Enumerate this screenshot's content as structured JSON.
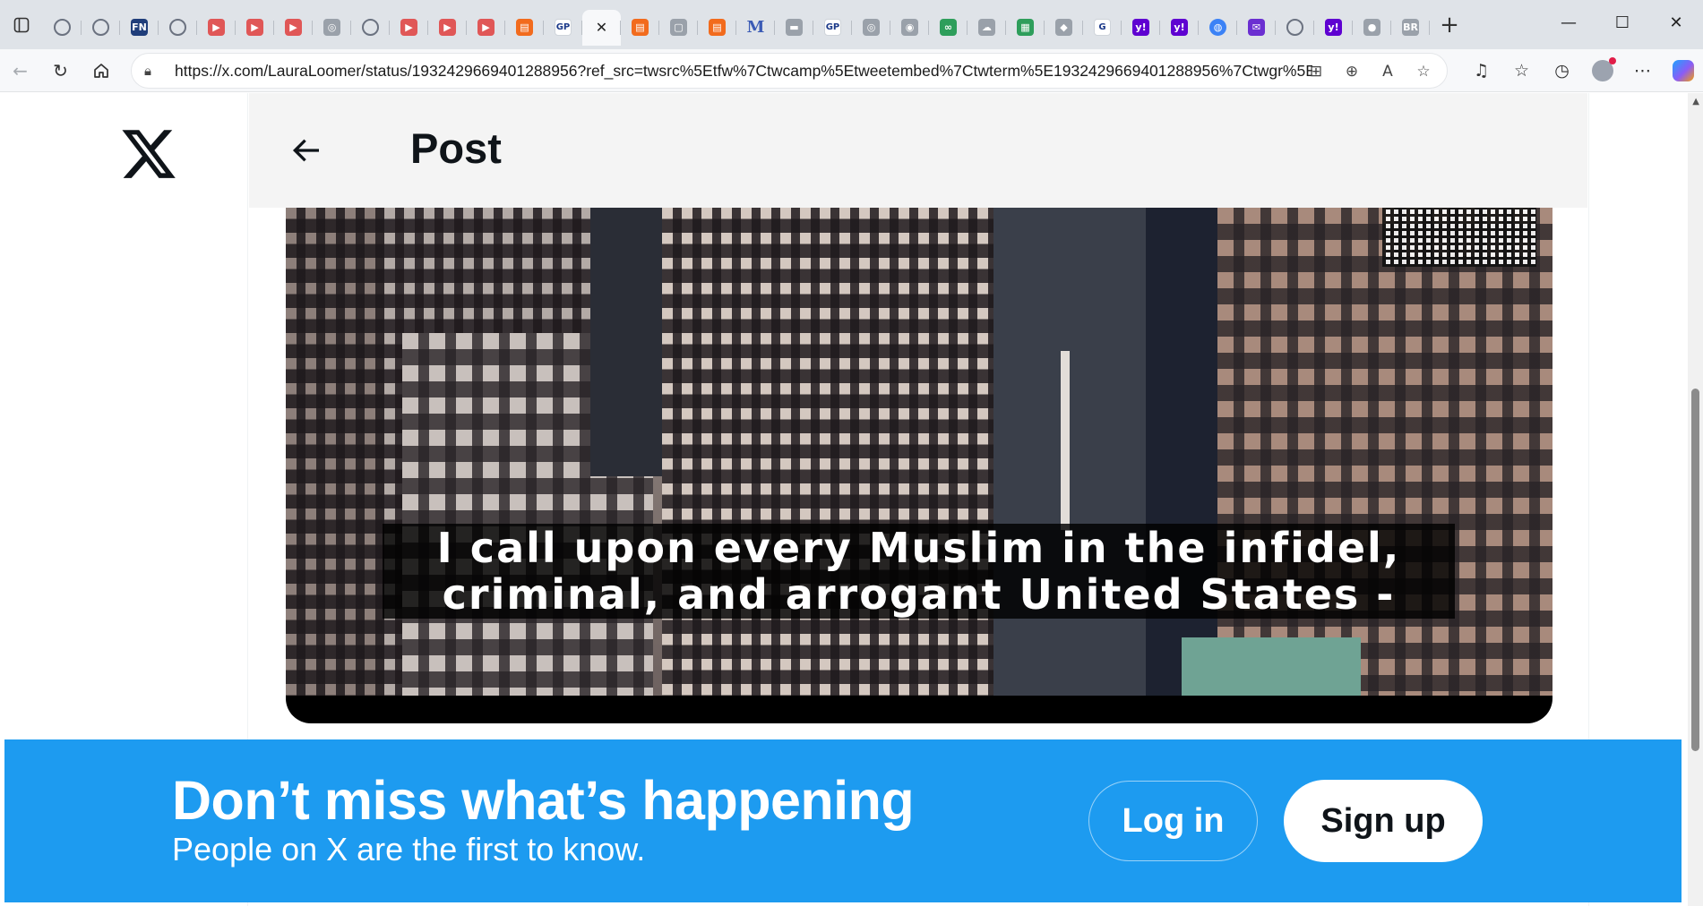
{
  "browser": {
    "tabs": [
      {
        "icon": "globe-icon",
        "kind": "globe",
        "glyph": ""
      },
      {
        "icon": "globe-icon",
        "kind": "globe",
        "glyph": ""
      },
      {
        "icon": "news-favicon-icon",
        "kind": "news",
        "glyph": "FN"
      },
      {
        "icon": "globe-icon",
        "kind": "globe",
        "glyph": ""
      },
      {
        "icon": "youtube-icon",
        "kind": "yt",
        "glyph": "▶"
      },
      {
        "icon": "youtube-icon",
        "kind": "yt",
        "glyph": "▶"
      },
      {
        "icon": "youtube-icon",
        "kind": "yt",
        "glyph": "▶"
      },
      {
        "icon": "seal-icon",
        "kind": "gray",
        "glyph": "◎"
      },
      {
        "icon": "globe-icon",
        "kind": "globe",
        "glyph": ""
      },
      {
        "icon": "youtube-icon",
        "kind": "yt",
        "glyph": "▶"
      },
      {
        "icon": "youtube-icon",
        "kind": "yt",
        "glyph": "▶"
      },
      {
        "icon": "youtube-icon",
        "kind": "yt",
        "glyph": "▶"
      },
      {
        "icon": "bookmark-icon",
        "kind": "book",
        "glyph": "▤"
      },
      {
        "icon": "gp-favicon-icon",
        "kind": "gp",
        "glyph": "GP"
      },
      {
        "icon": "x-favicon-icon",
        "kind": "active",
        "glyph": "✕"
      },
      {
        "icon": "bookmark-icon",
        "kind": "book",
        "glyph": "▤"
      },
      {
        "icon": "page-icon",
        "kind": "gray",
        "glyph": "▢"
      },
      {
        "icon": "bookmark-icon",
        "kind": "book",
        "glyph": "▤"
      },
      {
        "icon": "m-favicon-icon",
        "kind": "m",
        "glyph": "M"
      },
      {
        "icon": "image-icon",
        "kind": "gray",
        "glyph": "▬"
      },
      {
        "icon": "gp-favicon-icon",
        "kind": "gp",
        "glyph": "GP"
      },
      {
        "icon": "circle-icon",
        "kind": "gray",
        "glyph": "◎"
      },
      {
        "icon": "circle-icon",
        "kind": "gray",
        "glyph": "◉"
      },
      {
        "icon": "link-icon",
        "kind": "green",
        "glyph": "∞"
      },
      {
        "icon": "cloud-icon",
        "kind": "gray",
        "glyph": "☁"
      },
      {
        "icon": "sheet-icon",
        "kind": "green",
        "glyph": "▦"
      },
      {
        "icon": "shield-icon",
        "kind": "gray",
        "glyph": "◆"
      },
      {
        "icon": "google-icon",
        "kind": "gp",
        "glyph": "G"
      },
      {
        "icon": "yahoo-icon",
        "kind": "yahoo",
        "glyph": "y!"
      },
      {
        "icon": "yahoo-icon",
        "kind": "yahoo",
        "glyph": "y!"
      },
      {
        "icon": "circle-icon",
        "kind": "blue",
        "glyph": "◍"
      },
      {
        "icon": "mail-icon",
        "kind": "mail",
        "glyph": "✉"
      },
      {
        "icon": "globe-icon",
        "kind": "globe",
        "glyph": ""
      },
      {
        "icon": "yahoo-icon",
        "kind": "yahoo",
        "glyph": "y!"
      },
      {
        "icon": "image-icon",
        "kind": "gray",
        "glyph": "●"
      },
      {
        "icon": "logo-icon",
        "kind": "gray",
        "glyph": "BR"
      }
    ],
    "new_tab_glyph": "+",
    "window_controls": {
      "minimize": "—",
      "maximize": "☐",
      "close": "✕"
    },
    "url": "https://x.com/LauraLoomer/status/1932429669401288956?ref_src=twsrc%5Etfw%7Ctwcamp%5Etweetembed%7Ctwterm%5E1932429669401288956%7Ctwgr%5E..."
  },
  "page": {
    "header_title": "Post",
    "video": {
      "subtitle_line1": "I call upon every Muslim in the infidel,",
      "subtitle_line2": "criminal, and arrogant United States -"
    }
  },
  "banner": {
    "title": "Don’t miss what’s happening",
    "subtitle": "People on X are the first to know.",
    "login_label": "Log in",
    "signup_label": "Sign up",
    "color": "#1d9bf0"
  }
}
